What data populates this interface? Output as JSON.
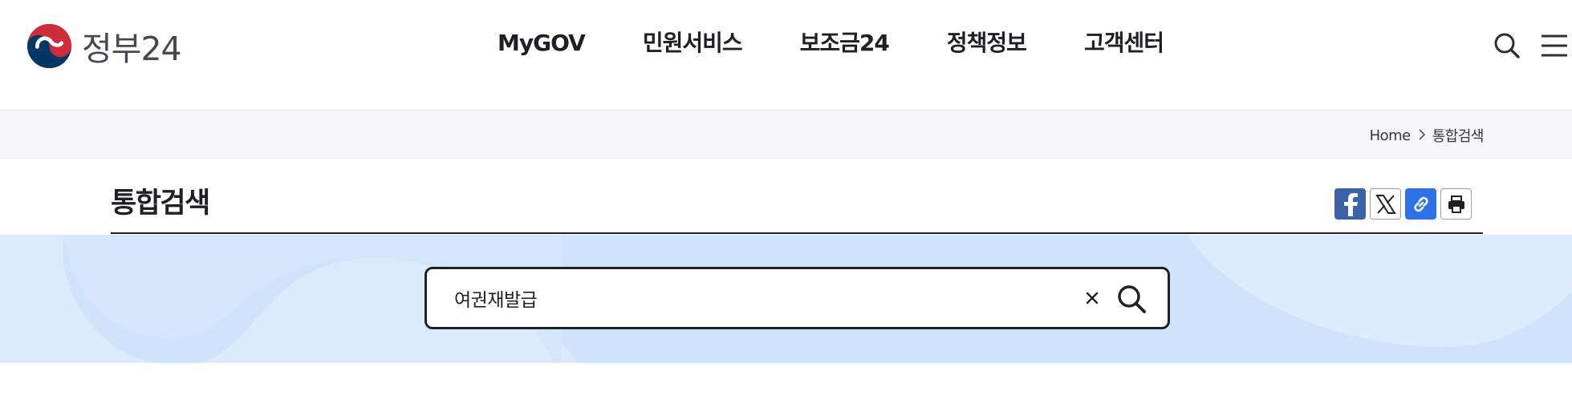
{
  "header": {
    "logo_text": "정부24",
    "nav": [
      "MyGOV",
      "민원서비스",
      "보조금24",
      "정책정보",
      "고객센터"
    ],
    "icons": {
      "search": "search-icon",
      "menu": "hamburger-menu-icon"
    }
  },
  "breadcrumb": {
    "home": "Home",
    "current": "통합검색",
    "separator_icon": "chevron-right-icon"
  },
  "page": {
    "title": "통합검색"
  },
  "share": {
    "icons": [
      "facebook-icon",
      "x-icon",
      "link-icon",
      "print-icon"
    ]
  },
  "search": {
    "value": "여권재발급",
    "clear_icon": "close-icon",
    "submit_icon": "search-icon"
  },
  "colors": {
    "brand_blue": "#003764",
    "brand_red": "#cd2e3a",
    "band_bg": "#cfe3fb",
    "facebook": "#3b62a8",
    "link": "#2f72e8"
  }
}
